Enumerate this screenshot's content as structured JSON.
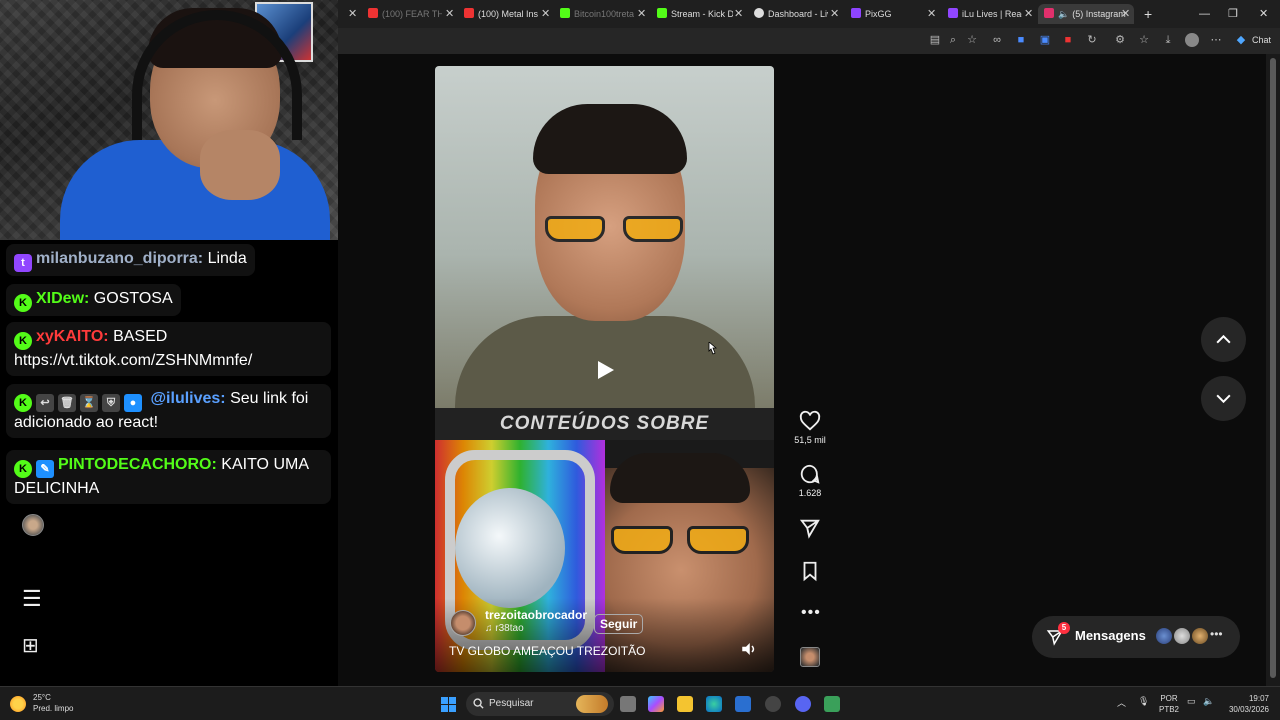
{
  "chat": {
    "messages": [
      {
        "badge": "twitch",
        "user": "milanbuzano_diporra:",
        "user_color": "#a0b0c8",
        "text": "Linda"
      },
      {
        "badge": "kick",
        "user": "XIDew:",
        "user_color": "#53fc18",
        "text": "GOSTOSA"
      },
      {
        "badge": "kick",
        "user": "xyKAITO:",
        "user_color": "#ff3b3b",
        "text": "BASED https://vt.tiktok.com/ZSHNMmnfe/"
      },
      {
        "badge": "kick",
        "user": "@ilulives:",
        "user_color": "#5aa0ff",
        "text": "Seu link foi adicionado ao react!"
      },
      {
        "badge": "kick",
        "user": "PINTODECACHORO:",
        "user_color": "#53fc18",
        "text": "KAITO UMA DELICINHA"
      }
    ],
    "menu_icon": "hamburger-menu-icon",
    "grid_icon": "apps-grid-icon"
  },
  "browser": {
    "tabs": [
      {
        "label": "(100) FEAR THE",
        "favicon": "#e33",
        "dim": true
      },
      {
        "label": "(100) Metal Instr",
        "favicon": "#e33",
        "dim": false
      },
      {
        "label": "Bitcoin100treta",
        "favicon": "#53fc18",
        "dim": true
      },
      {
        "label": "Stream - Kick Da",
        "favicon": "#53fc18",
        "dim": false
      },
      {
        "label": "Dashboard - Liv",
        "favicon": "#ddd",
        "dim": false
      },
      {
        "label": "PixGG",
        "favicon": "#8e44ff",
        "dim": false
      },
      {
        "label": "iLu Lives | React",
        "favicon": "#9146ff",
        "dim": false
      },
      {
        "label": "(5) Instagram",
        "favicon": "#e1306c",
        "dim": false,
        "active": true
      }
    ],
    "chat_button_label": "Chat"
  },
  "reel": {
    "banner_text": "CONTEÚDOS SOBRE",
    "username": "trezoitaobrocador",
    "audio": "r38tao",
    "follow_label": "Seguir",
    "caption": "TV GLOBO AMEAÇOU TREZOITÃO"
  },
  "actions": {
    "likes": "51,5 mil",
    "comments": "1.628"
  },
  "messages": {
    "label": "Mensagens",
    "unread": "5"
  },
  "taskbar": {
    "temperature": "25°C",
    "weather": "Pred. limpo",
    "search_placeholder": "Pesquisar",
    "lang_line1": "POR",
    "lang_line2": "PTB2",
    "time": "19:07",
    "date": "30/03/2026"
  },
  "colors": {
    "instagram_bg": "#0c0c0c",
    "kick_green": "#53fc18",
    "notification_red": "#ff3040"
  }
}
